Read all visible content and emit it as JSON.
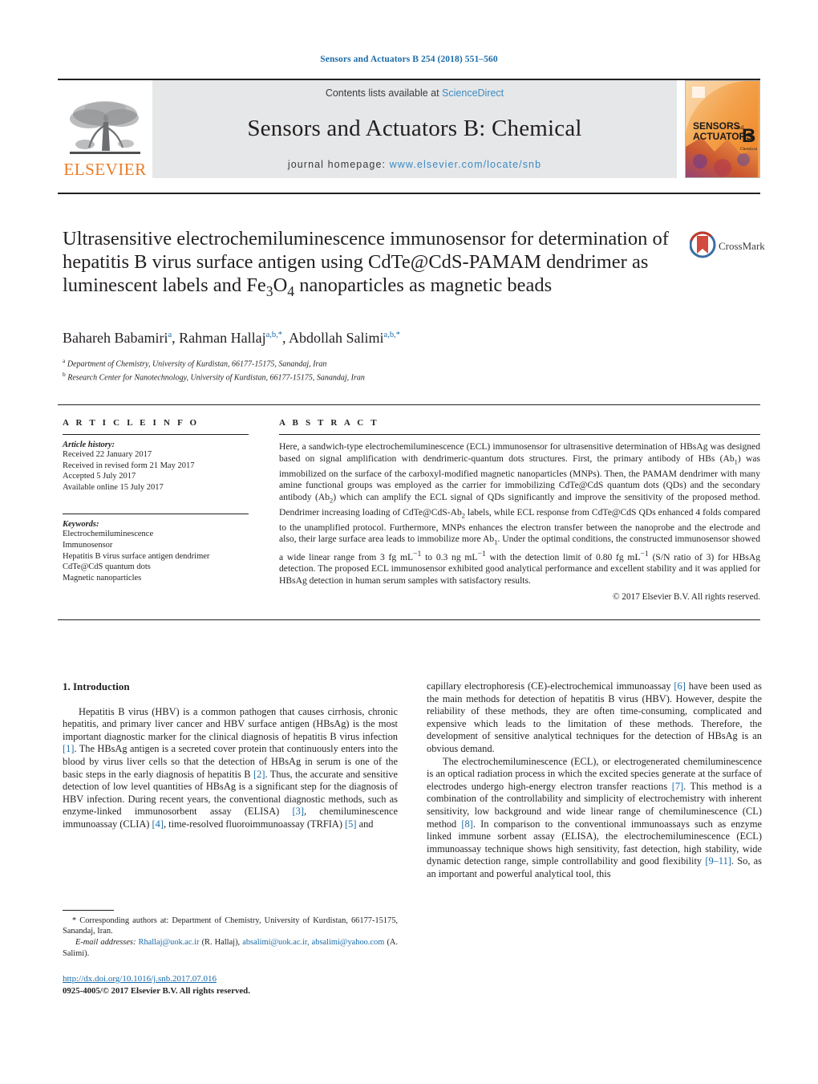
{
  "running_head": "Sensors and Actuators B 254 (2018) 551–560",
  "masthead": {
    "publisher": "ELSEVIER",
    "contents_prefix": "Contents lists available at ",
    "contents_link": "ScienceDirect",
    "journal_title": "Sensors and Actuators B: Chemical",
    "homepage_prefix": "journal homepage: ",
    "homepage_url": "www.elsevier.com/locate/snb",
    "cover_line1": "SENSORS",
    "cover_and": "and",
    "cover_line2": "ACTUATORS",
    "cover_letter": "B",
    "cover_sub": "Chemical"
  },
  "crossmark": {
    "label": "CrossMark"
  },
  "title": "Ultrasensitive electrochemiluminescence immunosensor for determination of hepatitis B virus surface antigen using CdTe@CdS-PAMAM dendrimer as luminescent labels and Fe3O4 nanoparticles as magnetic beads",
  "authors": {
    "a1_name": "Bahareh Babamiri",
    "a1_sup": "a",
    "a2_name": ", Rahman Hallaj",
    "a2_sup": "a,b,*",
    "a3_name": ", Abdollah Salimi",
    "a3_sup": "a,b,*"
  },
  "affiliations": [
    {
      "mark": "a",
      "text": "Department of Chemistry, University of Kurdistan, 66177-15175, Sanandaj, Iran"
    },
    {
      "mark": "b",
      "text": "Research Center for Nanotechnology, University of Kurdistan, 66177-15175, Sanandaj, Iran"
    }
  ],
  "article_info": {
    "heading": "A R T I C L E   I N F O",
    "history_label": "Article history:",
    "history": [
      "Received 22 January 2017",
      "Received in revised form 21 May 2017",
      "Accepted 5 July 2017",
      "Available online 15 July 2017"
    ],
    "keywords_label": "Keywords:",
    "keywords": [
      "Electrochemiluminescence",
      "Immunosensor",
      "Hepatitis B virus surface antigen dendrimer",
      "CdTe@CdS quantum dots",
      "Magnetic nanoparticles"
    ]
  },
  "abstract": {
    "heading": "A B S T R A C T",
    "body": "Here, a sandwich-type electrochemiluminescence (ECL) immunosensor for ultrasensitive determination of HBsAg was designed based on signal amplification with dendrimeric-quantum dots structures. First, the primary antibody of HBs (Ab1) was immobilized on the surface of the carboxyl-modified magnetic nanoparticles (MNPs). Then, the PAMAM dendrimer with many amine functional groups was employed as the carrier for immobilizing CdTe@CdS quantum dots (QDs) and the secondary antibody (Ab2) which can amplify the ECL signal of QDs significantly and improve the sensitivity of the proposed method. Dendrimer increasing loading of CdTe@CdS-Ab2 labels, while ECL response from CdTe@CdS QDs enhanced 4 folds compared to the unamplified protocol. Furthermore, MNPs enhances the electron transfer between the nanoprobe and the electrode and also, their large surface area leads to immobilize more Ab1. Under the optimal conditions, the constructed immunosensor showed a wide linear range from 3 fg mL−1 to 0.3 ng mL−1 with the detection limit of 0.80 fg mL−1 (S/N ratio of 3) for HBsAg detection. The proposed ECL immunosensor exhibited good analytical performance and excellent stability and it was applied for HBsAg detection in human serum samples with satisfactory results.",
    "copyright": "© 2017 Elsevier B.V. All rights reserved."
  },
  "body": {
    "section_heading": "1.  Introduction",
    "left_para1": "Hepatitis B virus (HBV) is a common pathogen that causes cirrhosis, chronic hepatitis, and primary liver cancer and HBV surface antigen (HBsAg) is the most important diagnostic marker for the clinical diagnosis of hepatitis B virus infection [1]. The HBsAg antigen is a secreted cover protein that continuously enters into the blood by virus liver cells so that the detection of HBsAg in serum is one of the basic steps in the early diagnosis of hepatitis B [2]. Thus, the accurate and sensitive detection of low level quantities of HBsAg is a significant step for the diagnosis of HBV infection. During recent years, the conventional diagnostic methods, such as enzyme-linked immunosorbent assay (ELISA) [3], chemiluminescence immunoassay (CLIA) [4], time-resolved fluoroimmunoassay (TRFIA) [5] and",
    "right_para1": "capillary electrophoresis (CE)-electrochemical immunoassay [6] have been used as the main methods for detection of hepatitis B virus (HBV). However, despite the reliability of these methods, they are often time-consuming, complicated and expensive which leads to the limitation of these methods. Therefore, the development of sensitive analytical techniques for the detection of HBsAg is an obvious demand.",
    "right_para2": "The electrochemiluminescence (ECL), or electrogenerated chemiluminescence is an optical radiation process in which the excited species generate at the surface of electrodes undergo high-energy electron transfer reactions [7]. This method is a combination of the controllability and simplicity of electrochemistry with inherent sensitivity, low background and wide linear range of chemiluminescence (CL) method [8]. In comparison to the conventional immunoassays such as enzyme linked immune sorbent assay (ELISA), the electrochemiluminescence (ECL) immunoassay technique shows high sensitivity, fast detection, high stability, wide dynamic detection range, simple controllability and good flexibility [9–11]. So, as an important and powerful analytical tool, this"
  },
  "footnotes": {
    "corresponding": "* Corresponding authors at: Department of Chemistry, University of Kurdistan, 66177-15175, Sanandaj, Iran.",
    "email_label": "E-mail addresses:",
    "email1": "Rhallaj@uok.ac.ir",
    "email1_who": "(R. Hallaj),",
    "email2": "absalimi@uok.ac.ir,",
    "email3": "absalimi@yahoo.com",
    "email3_who": "(A. Salimi)."
  },
  "footer": {
    "doi": "http://dx.doi.org/10.1016/j.snb.2017.07.016",
    "issn": "0925-4005/© 2017 Elsevier B.V. All rights reserved."
  },
  "colors": {
    "link_blue": "#1a6ba8",
    "sciencedirect_blue": "#3b8bc4",
    "elsevier_orange": "#ec7c26",
    "band_gray": "#e6e7e8"
  }
}
